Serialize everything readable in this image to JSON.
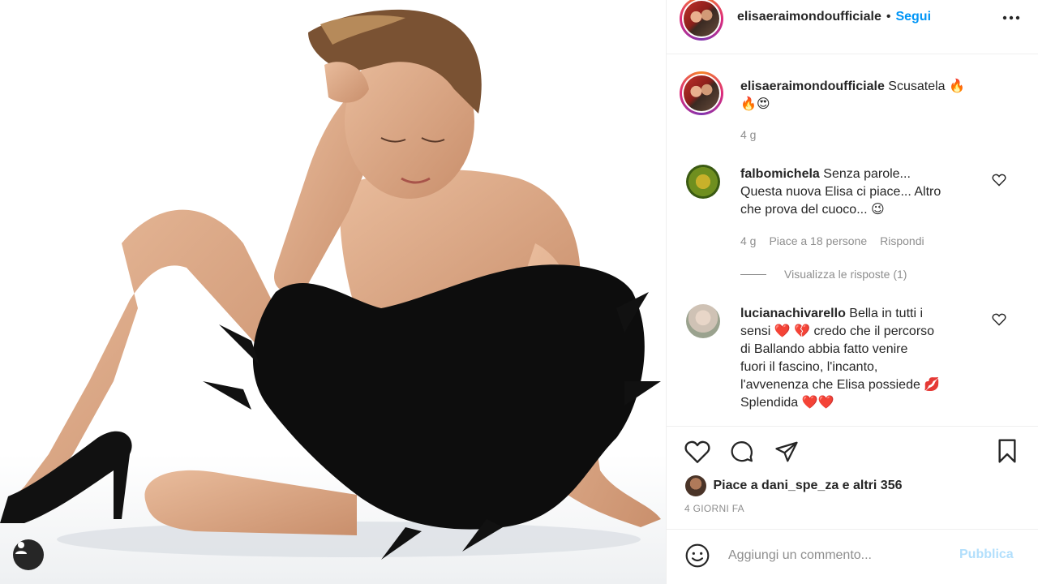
{
  "post": {
    "author": "elisaeraimondoufficiale",
    "separator": "•",
    "follow_label": "Segui",
    "more_icon": "more-horizontal-icon",
    "caption_text": "Scusatela",
    "caption_emoji_line1": "🔥",
    "caption_emoji_line2": "🔥😍",
    "caption_time": "4 g",
    "likes_text": "Piace a dani_spe_za e altri 356",
    "date": "4 GIORNI FA"
  },
  "comments": [
    {
      "user": "falbomichela",
      "lines": [
        "Senza parole...",
        "Questa nuova Elisa ci piace... Altro",
        "che prova del cuoco... 😉"
      ],
      "time": "4 g",
      "likes": "Piace a 18 persone",
      "reply_label": "Rispondi",
      "replies_label": "Visualizza le risposte (1)"
    },
    {
      "user": "lucianachivarello",
      "lines": [
        "Bella in tutti i",
        "sensi ❤️ 💔 credo che il percorso",
        "di Ballando abbia fatto venire",
        "fuori il fascino, l'incanto,",
        "l'avvenenza che Elisa possiede 💋",
        "Splendida ❤️❤️"
      ]
    }
  ],
  "add_comment": {
    "placeholder": "Aggiungi un commento...",
    "publish_label": "Pubblica"
  },
  "icons": {
    "like": "heart-icon",
    "comment": "comment-icon",
    "share": "paper-plane-icon",
    "save": "bookmark-icon",
    "emoji": "emoji-smile-icon",
    "user_tag": "user-tag-icon"
  },
  "colors": {
    "link_blue": "#0095f6",
    "publish_disabled": "#b2dffc",
    "meta_grey": "#8e8e8e",
    "text": "#262626"
  }
}
